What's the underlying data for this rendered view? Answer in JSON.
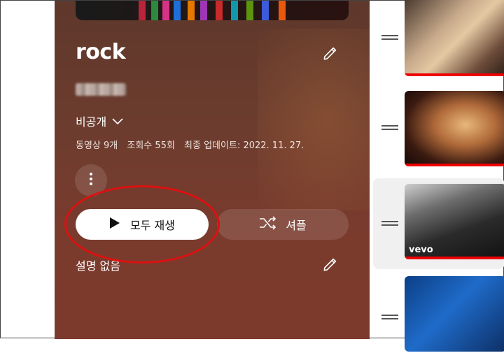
{
  "playlist": {
    "title": "rock",
    "privacy_label": "비공개",
    "stats": {
      "video_count": "동영상 9개",
      "view_count": "조회수 55회",
      "last_updated": "최종 업데이트: 2022. 11. 27."
    },
    "description": "설명 없음"
  },
  "actions": {
    "play_all_label": "모두 재생",
    "shuffle_label": "셔플"
  },
  "icons": {
    "edit_title": "pencil-icon",
    "edit_description": "pencil-icon",
    "privacy_dropdown": "chevron-down-icon",
    "more": "more-vert-icon",
    "play": "play-icon",
    "shuffle": "shuffle-icon",
    "drag": "drag-handle-icon"
  },
  "colors": {
    "panel_background": "#6b3c2e",
    "annotation_circle": "#dd1111",
    "progress_red": "#ee0000",
    "selected_row": "#f0f0f0"
  },
  "videos": [
    {
      "watched_fraction": 1.0,
      "thumbnail_badge": ""
    },
    {
      "watched_fraction": 1.0,
      "thumbnail_badge": ""
    },
    {
      "watched_fraction": 1.0,
      "thumbnail_badge": "vevo"
    },
    {
      "watched_fraction": 0.0,
      "thumbnail_badge": ""
    }
  ]
}
